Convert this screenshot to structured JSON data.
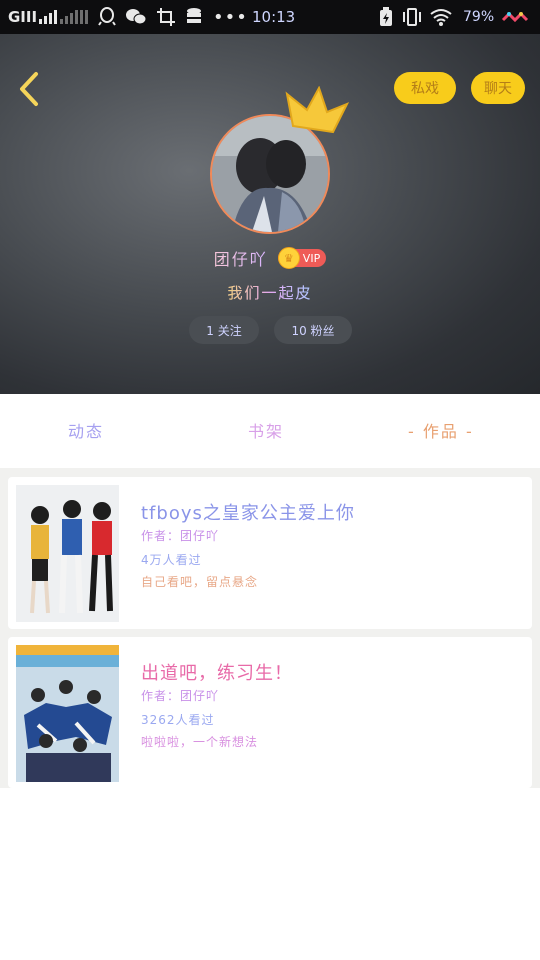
{
  "status_bar": {
    "carrier": "GIII",
    "time": "10:13",
    "battery": "79%",
    "icons": [
      "qq-icon",
      "wechat-icon",
      "screenshot-icon",
      "database-icon",
      "more-dots-icon",
      "charging-icon",
      "vibrate-icon",
      "wifi-icon",
      "rainbow-icon"
    ]
  },
  "header": {
    "buttons": {
      "primary": "私戏",
      "secondary": "聊天"
    },
    "username": "团仔吖",
    "vip_label": "VIP",
    "bio": "我们一起皮",
    "stats": {
      "following": "1 关注",
      "followers": "10 粉丝"
    },
    "colors": {
      "pill": "#f8cc1b",
      "vip": "#ef5b57"
    }
  },
  "tabs": [
    "动态",
    "书架",
    "- 作品 -"
  ],
  "works": [
    {
      "title": "tfboys之皇家公主爱上你",
      "author": "作者：团仔吖",
      "reads": "4万人看过",
      "desc": "自己看吧，留点悬念"
    },
    {
      "title": "出道吧，练习生！",
      "author": "作者：团仔吖",
      "reads": "3262人看过",
      "desc": "啦啦啦，一个新想法"
    }
  ]
}
